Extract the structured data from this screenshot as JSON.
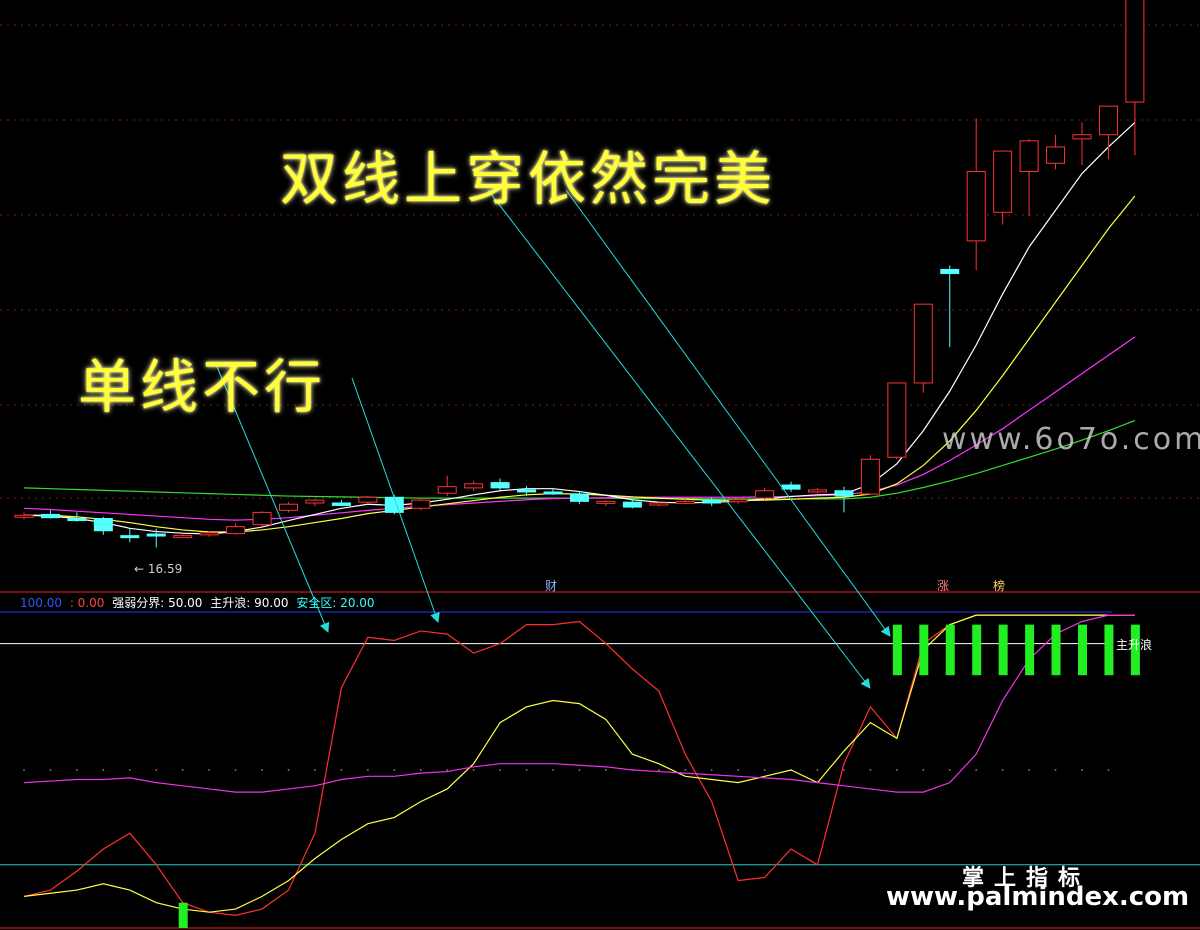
{
  "annotations": {
    "top": "双线上穿依然完美",
    "left": "单线不行"
  },
  "watermarks": {
    "site": "www.6o7o.com",
    "brand_cn": "掌上指标",
    "url": "www.palmindex.com"
  },
  "price_panel": {
    "low_marker": "16.59",
    "event_tags": {
      "cai": "财",
      "zhang": "涨",
      "bang": "榜"
    }
  },
  "indicator_panel": {
    "header": [
      {
        "text": "100.00",
        "color": "#3355ff"
      },
      {
        "text": ": 0.00",
        "color": "#ff4040"
      },
      {
        "text": "强弱分界: 50.00",
        "color": "#ffffff"
      },
      {
        "text": "主升浪: 90.00",
        "color": "#ffffff"
      },
      {
        "text": "安全区: 20.00",
        "color": "#33ffff"
      }
    ],
    "main_wave_label": "主升浪"
  },
  "colors": {
    "up": "#ff3232",
    "down": "#54ffff",
    "ma_white": "#ffffff",
    "ma_yellow": "#ffff44",
    "ma_magenta": "#ff33ff",
    "ma_green": "#33dd33",
    "annotation": "#ffff33",
    "arrow": "#22dddd"
  },
  "chart_data": [
    {
      "type": "candlestick",
      "ohlc": [
        [
          17.35,
          17.45,
          17.28,
          17.38
        ],
        [
          17.4,
          17.5,
          17.3,
          17.32
        ],
        [
          17.3,
          17.45,
          17.22,
          17.25
        ],
        [
          17.3,
          17.34,
          16.9,
          17.0
        ],
        [
          16.88,
          17.05,
          16.72,
          16.85
        ],
        [
          16.92,
          17.05,
          16.59,
          16.9
        ],
        [
          16.86,
          16.92,
          16.82,
          16.88
        ],
        [
          16.9,
          16.98,
          16.85,
          16.95
        ],
        [
          16.93,
          17.18,
          16.9,
          17.1
        ],
        [
          17.15,
          17.48,
          17.1,
          17.45
        ],
        [
          17.5,
          17.7,
          17.45,
          17.65
        ],
        [
          17.68,
          17.78,
          17.6,
          17.75
        ],
        [
          17.68,
          17.76,
          17.6,
          17.62
        ],
        [
          17.7,
          17.85,
          17.65,
          17.82
        ],
        [
          17.82,
          17.88,
          17.4,
          17.45
        ],
        [
          17.55,
          17.8,
          17.5,
          17.75
        ],
        [
          17.92,
          18.35,
          17.85,
          18.08
        ],
        [
          18.05,
          18.22,
          17.98,
          18.15
        ],
        [
          18.18,
          18.28,
          17.98,
          18.05
        ],
        [
          18.0,
          18.1,
          17.85,
          17.95
        ],
        [
          17.95,
          18.05,
          17.88,
          17.92
        ],
        [
          17.9,
          17.95,
          17.65,
          17.72
        ],
        [
          17.68,
          17.75,
          17.6,
          17.72
        ],
        [
          17.7,
          17.78,
          17.55,
          17.58
        ],
        [
          17.65,
          17.7,
          17.6,
          17.68
        ],
        [
          17.68,
          17.78,
          17.65,
          17.72
        ],
        [
          17.75,
          17.82,
          17.6,
          17.68
        ],
        [
          17.72,
          17.8,
          17.66,
          17.76
        ],
        [
          17.8,
          18.05,
          17.75,
          17.98
        ],
        [
          18.12,
          18.2,
          17.95,
          18.02
        ],
        [
          17.97,
          18.05,
          17.92,
          18.0
        ],
        [
          17.98,
          18.08,
          17.45,
          17.85
        ],
        [
          17.9,
          18.85,
          17.88,
          18.75
        ],
        [
          18.8,
          20.62,
          18.75,
          20.62
        ],
        [
          20.62,
          22.55,
          20.38,
          22.55
        ],
        [
          23.4,
          23.5,
          21.5,
          23.3
        ],
        [
          24.1,
          27.1,
          23.38,
          25.8
        ],
        [
          24.8,
          26.1,
          24.5,
          26.3
        ],
        [
          25.8,
          26.6,
          24.7,
          26.55
        ],
        [
          26.0,
          26.7,
          25.85,
          26.4
        ],
        [
          26.6,
          27.0,
          25.95,
          26.7
        ],
        [
          26.7,
          27.3,
          26.1,
          27.4
        ],
        [
          27.5,
          28.8,
          26.2,
          30.5
        ]
      ],
      "ma_white": [
        17.38,
        17.36,
        17.3,
        17.2,
        17.06,
        16.98,
        16.94,
        16.92,
        16.98,
        17.09,
        17.25,
        17.4,
        17.55,
        17.65,
        17.62,
        17.68,
        17.77,
        17.88,
        17.98,
        18.03,
        18.03,
        17.96,
        17.87,
        17.76,
        17.7,
        17.68,
        17.7,
        17.72,
        17.78,
        17.84,
        17.88,
        17.9,
        18.14,
        18.64,
        19.45,
        20.42,
        21.55,
        22.8,
        23.95,
        24.85,
        25.75,
        26.4,
        27.0
      ],
      "ma_yellow": [
        17.38,
        17.38,
        17.34,
        17.28,
        17.2,
        17.1,
        17.02,
        16.97,
        16.97,
        17.02,
        17.1,
        17.2,
        17.3,
        17.42,
        17.5,
        17.58,
        17.66,
        17.74,
        17.82,
        17.88,
        17.91,
        17.9,
        17.87,
        17.83,
        17.8,
        17.77,
        17.75,
        17.74,
        17.75,
        17.77,
        17.8,
        17.82,
        17.9,
        18.15,
        18.6,
        19.2,
        19.95,
        20.8,
        21.7,
        22.6,
        23.5,
        24.4,
        25.2
      ],
      "ma_magenta": [
        17.55,
        17.52,
        17.48,
        17.44,
        17.4,
        17.36,
        17.32,
        17.28,
        17.26,
        17.28,
        17.32,
        17.38,
        17.44,
        17.5,
        17.55,
        17.6,
        17.64,
        17.68,
        17.72,
        17.76,
        17.79,
        17.8,
        17.81,
        17.82,
        17.82,
        17.82,
        17.82,
        17.82,
        17.83,
        17.84,
        17.86,
        17.88,
        17.96,
        18.12,
        18.38,
        18.72,
        19.1,
        19.5,
        19.95,
        20.4,
        20.85,
        21.3,
        21.75
      ],
      "ma_green": [
        18.05,
        18.03,
        18.01,
        17.99,
        17.97,
        17.95,
        17.93,
        17.91,
        17.89,
        17.87,
        17.85,
        17.84,
        17.83,
        17.82,
        17.81,
        17.8,
        17.8,
        17.8,
        17.8,
        17.8,
        17.8,
        17.8,
        17.8,
        17.79,
        17.79,
        17.79,
        17.78,
        17.78,
        17.78,
        17.78,
        17.78,
        17.78,
        17.82,
        17.92,
        18.06,
        18.22,
        18.4,
        18.6,
        18.8,
        19.0,
        19.22,
        19.45,
        19.7
      ]
    },
    {
      "type": "line",
      "ylim": [
        0,
        100
      ],
      "series": [
        {
          "values": [
            10,
            12,
            18,
            25,
            30,
            20,
            8,
            5,
            4,
            6,
            12,
            30,
            76,
            92,
            91,
            94,
            93,
            87,
            90,
            96,
            96,
            97,
            90,
            82,
            75,
            55,
            40,
            15,
            16,
            25,
            20,
            52,
            70,
            60,
            90,
            96,
            99,
            99,
            99,
            99,
            99,
            99,
            99
          ]
        },
        {
          "values": [
            10,
            11,
            12,
            14,
            12,
            8,
            6,
            5,
            6,
            10,
            15,
            22,
            28,
            33,
            35,
            40,
            44,
            52,
            65,
            70,
            72,
            71,
            66,
            55,
            52,
            48,
            47,
            46,
            48,
            50,
            46,
            56,
            65,
            60,
            88,
            96,
            99,
            99,
            99,
            99,
            99,
            99,
            99
          ]
        },
        {
          "values": [
            46,
            46.5,
            47,
            47,
            47.5,
            46,
            45,
            44,
            43,
            43,
            44,
            45,
            47,
            48,
            48,
            49,
            49.5,
            51,
            52,
            52,
            52,
            51.5,
            51,
            50,
            49.5,
            49,
            48.5,
            48,
            47.5,
            47,
            46,
            45,
            44,
            43,
            43,
            46,
            55,
            72,
            85,
            93,
            97,
            99,
            99
          ]
        }
      ],
      "signal_bars": [
        6,
        33,
        34,
        35,
        36,
        37,
        38,
        39,
        40,
        41,
        42
      ]
    }
  ]
}
